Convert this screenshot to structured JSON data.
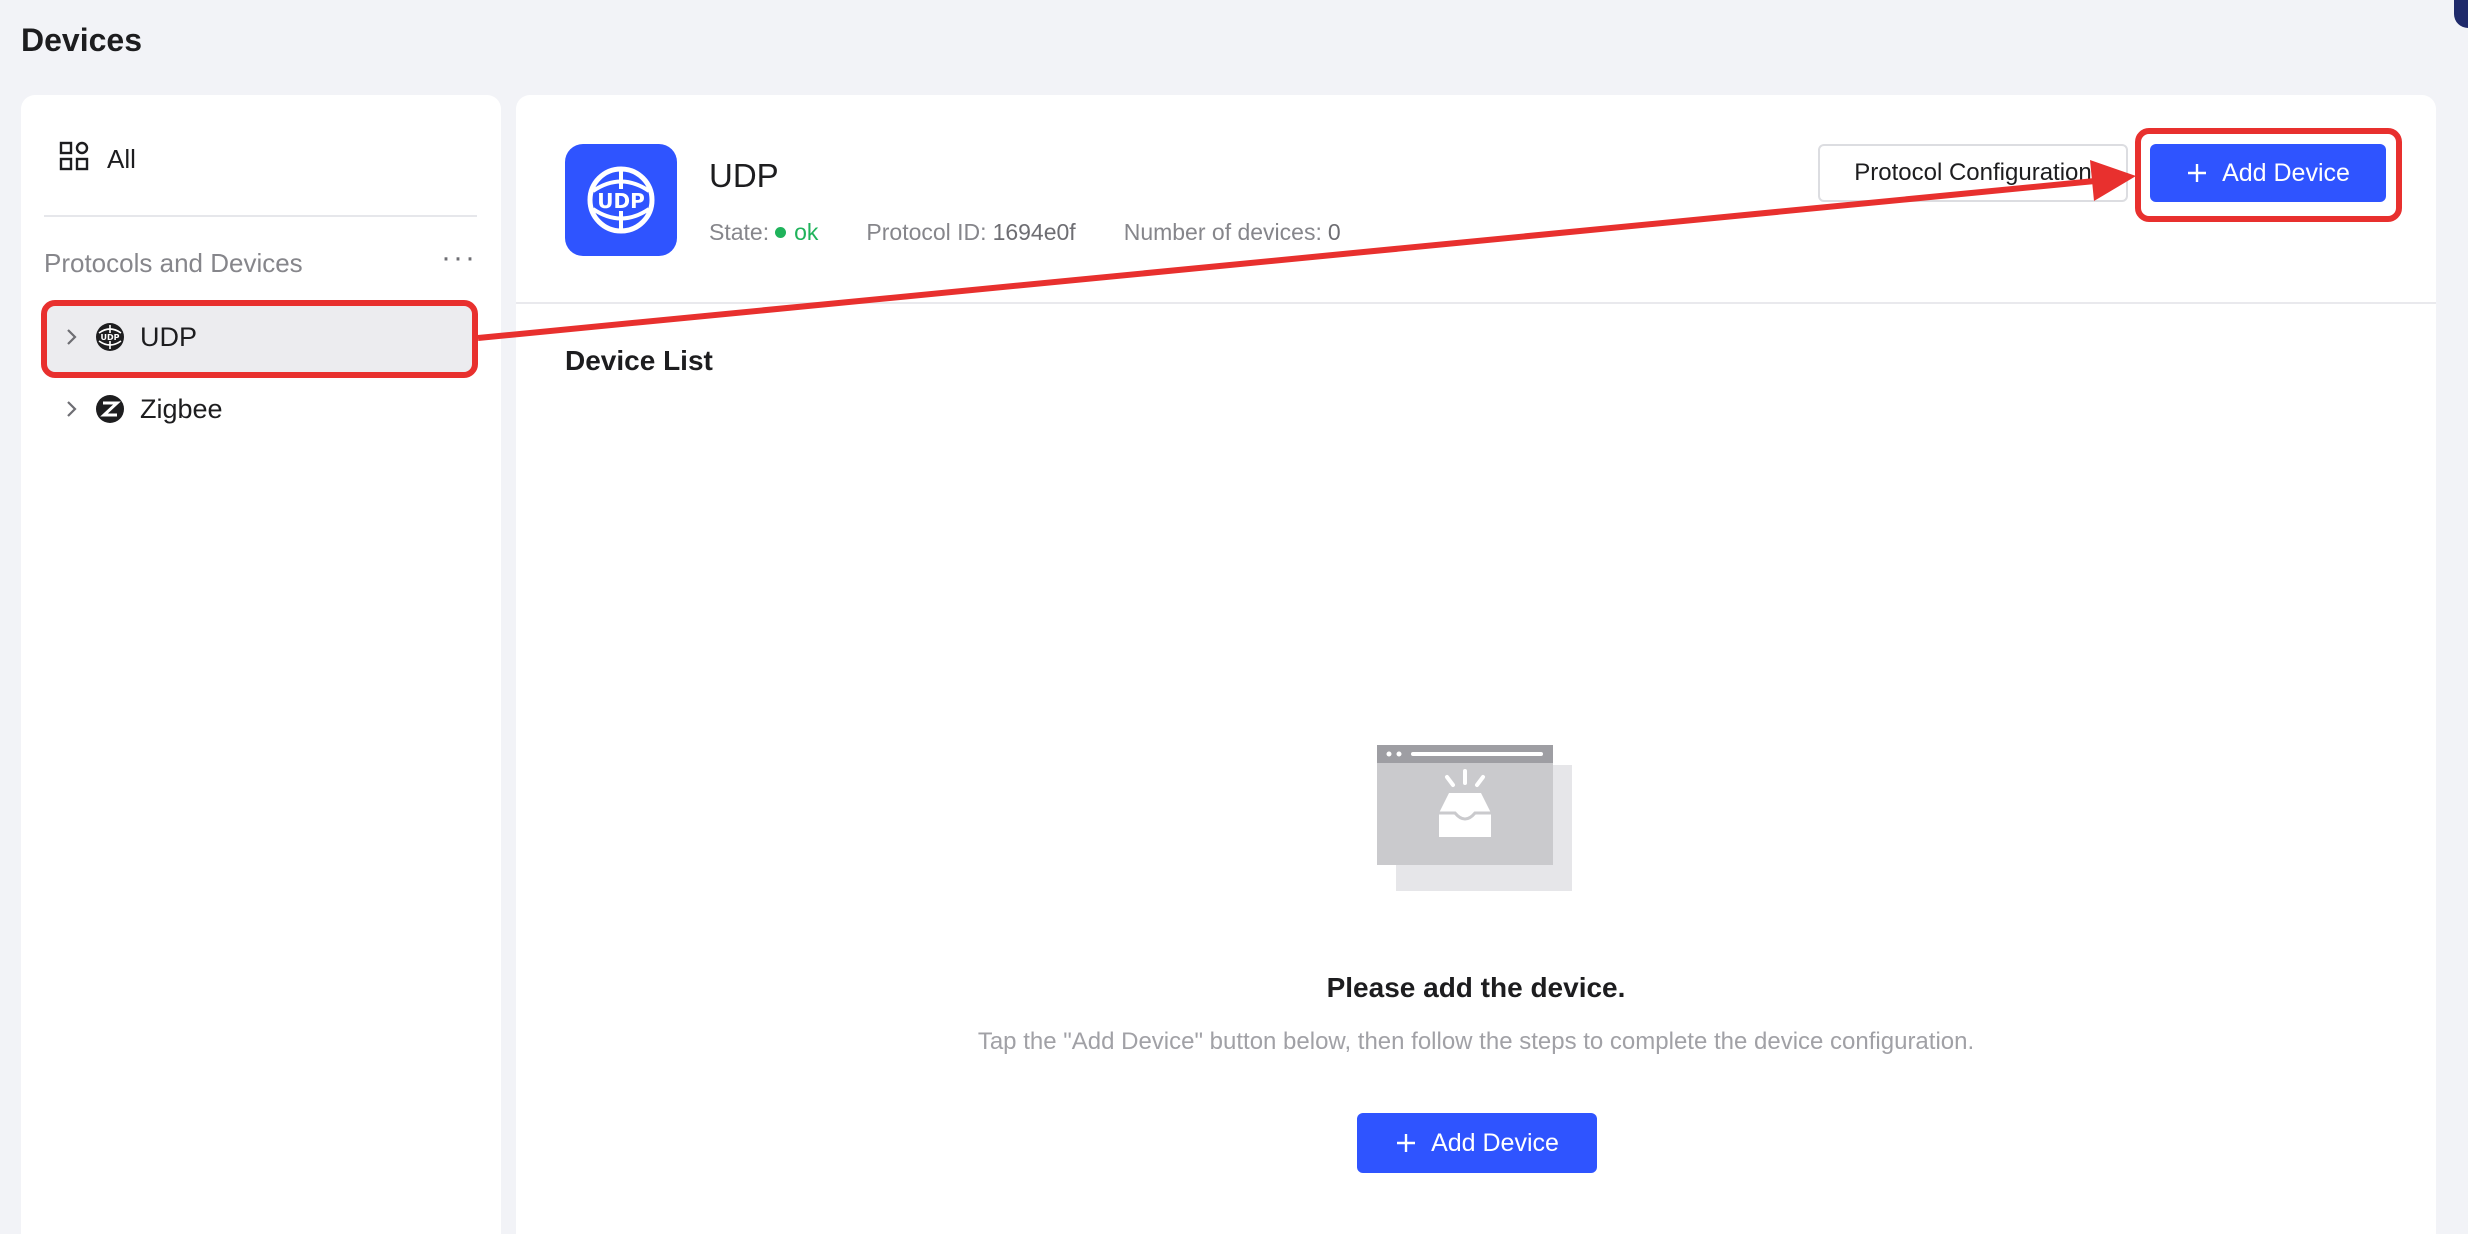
{
  "page": {
    "title": "Devices"
  },
  "sidebar": {
    "all_label": "All",
    "section_label": "Protocols and Devices",
    "more_label": "···",
    "items": [
      {
        "label": "UDP",
        "icon": "udp-globe-icon",
        "selected": true
      },
      {
        "label": "Zigbee",
        "icon": "zigbee-icon",
        "selected": false
      }
    ]
  },
  "protocol": {
    "name": "UDP",
    "logo_text": "UDP",
    "state_label": "State:",
    "state_value": "ok",
    "id_label": "Protocol ID:",
    "id_value": "1694e0f",
    "devices_label": "Number of devices:",
    "devices_value": "0",
    "config_button": "Protocol Configuration",
    "add_button": "Add Device"
  },
  "device_list": {
    "title": "Device List",
    "empty_title": "Please add the device.",
    "empty_desc": "Tap the \"Add Device\" button below, then follow the steps to complete the device configuration.",
    "add_button": "Add Device"
  },
  "colors": {
    "primary": "#2f54ff",
    "ok": "#1fb35b",
    "annotation": "#e8302e"
  }
}
